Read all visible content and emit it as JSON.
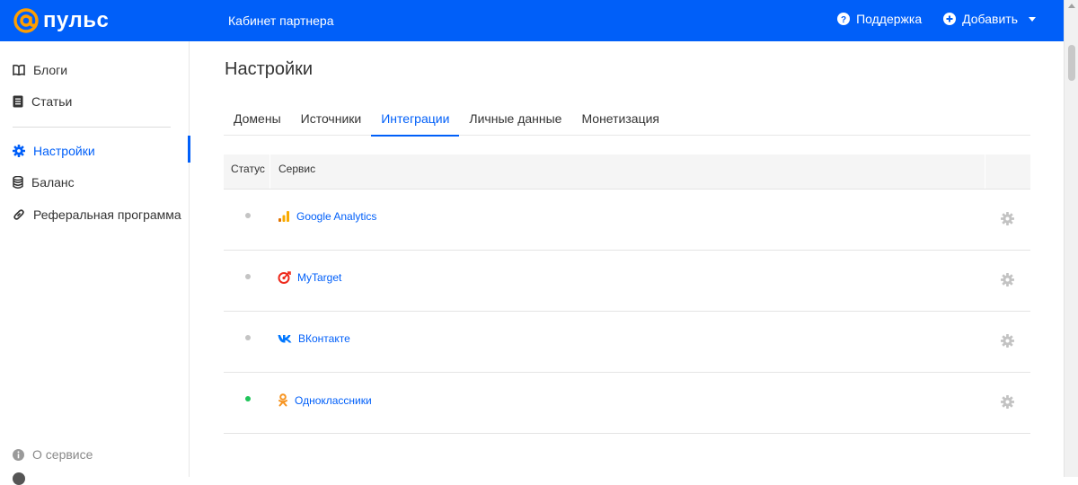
{
  "header": {
    "logo_text": "пульс",
    "section_title": "Кабинет партнера",
    "support_label": "Поддержка",
    "add_label": "Добавить",
    "brand_color": "#005ff9"
  },
  "sidebar": {
    "items": [
      {
        "label": "Блоги",
        "icon": "book-icon"
      },
      {
        "label": "Статьи",
        "icon": "document-icon"
      },
      {
        "label": "Настройки",
        "icon": "gear-icon",
        "active": true
      },
      {
        "label": "Баланс",
        "icon": "database-icon"
      },
      {
        "label": "Реферальная программа",
        "icon": "link-icon"
      }
    ],
    "about_label": "О сервисе"
  },
  "main": {
    "title": "Настройки",
    "tabs": [
      {
        "label": "Домены"
      },
      {
        "label": "Источники"
      },
      {
        "label": "Интеграции",
        "active": true
      },
      {
        "label": "Личные данные"
      },
      {
        "label": "Монетизация"
      }
    ],
    "table": {
      "headers": {
        "status": "Статус",
        "service": "Сервис"
      },
      "rows": [
        {
          "service": "Google Analytics",
          "icon": "google-analytics-icon",
          "status": "inactive"
        },
        {
          "service": "MyTarget",
          "icon": "mytarget-icon",
          "status": "inactive"
        },
        {
          "service": "ВКонтакте",
          "icon": "vk-icon",
          "status": "inactive"
        },
        {
          "service": "Одноклассники",
          "icon": "odnoklassniki-icon",
          "status": "active"
        }
      ]
    }
  },
  "colors": {
    "status_active": "#1fc45a",
    "status_inactive": "#c4c4c4",
    "link": "#005ff9"
  }
}
